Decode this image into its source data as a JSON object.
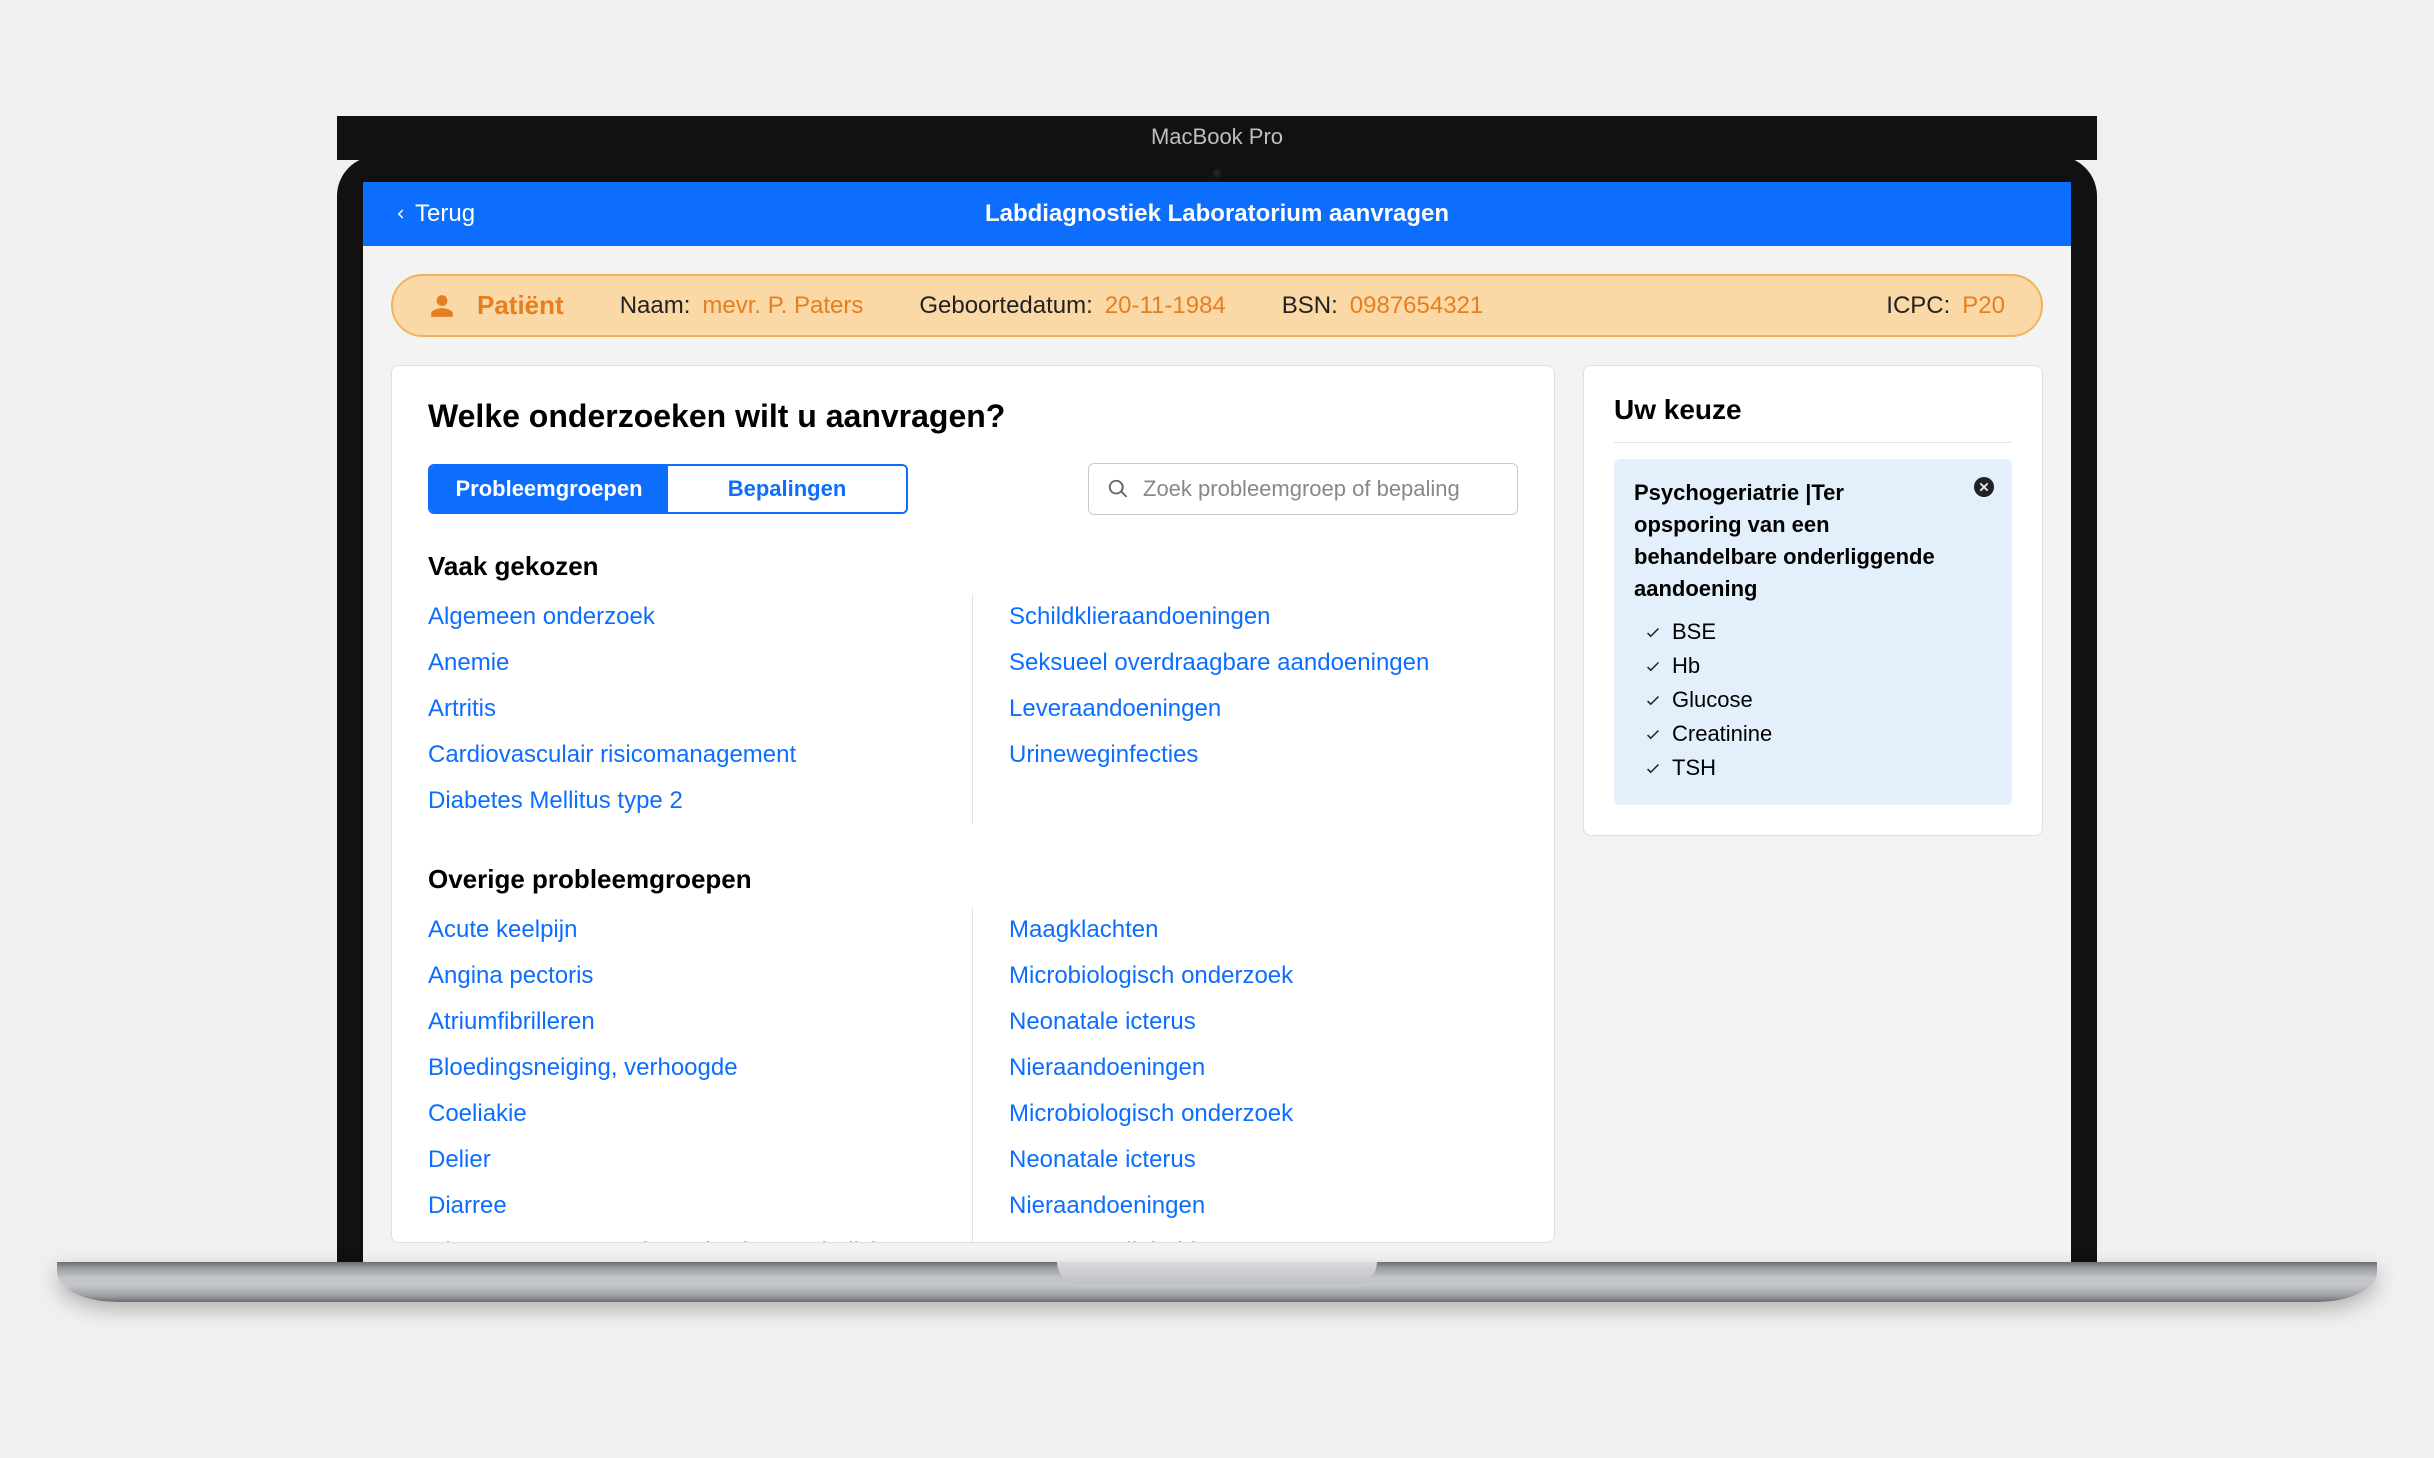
{
  "device_label": "MacBook Pro",
  "header": {
    "back_label": "Terug",
    "title": "Labdiagnostiek Laboratorium aanvragen"
  },
  "patient": {
    "badge_label": "Patiënt",
    "name_label": "Naam:",
    "name_value": "mevr. P. Paters",
    "dob_label": "Geboortedatum:",
    "dob_value": "20-11-1984",
    "bsn_label": "BSN:",
    "bsn_value": "0987654321",
    "icpc_label": "ICPC:",
    "icpc_value": "P20"
  },
  "main": {
    "heading": "Welke onderzoeken wilt u aanvragen?",
    "tab_groups": "Probleemgroepen",
    "tab_determinations": "Bepalingen",
    "search_placeholder": "Zoek probleemgroep of bepaling",
    "section_frequent": "Vaak gekozen",
    "frequent_col1": [
      "Algemeen onderzoek",
      "Anemie",
      "Artritis",
      "Cardiovasculair risicomanagement",
      "Diabetes Mellitus type 2"
    ],
    "frequent_col2": [
      "Schildklieraandoeningen",
      "Seksueel overdraagbare aandoeningen",
      "Leveraandoeningen",
      "Urineweginfecties"
    ],
    "section_other": "Overige probleemgroepen",
    "other_col1": [
      "Acute keelpijn",
      "Angina pectoris",
      "Atriumfibrilleren",
      "Bloedingsneiging, verhoogde",
      "Coeliakie",
      "Delier",
      "Diarree",
      "Diepe veneuze trombose (en longembolie)"
    ],
    "other_col2": [
      "Maagklachten",
      "Microbiologisch onderzoek",
      "Neonatale icterus",
      "Nieraandoeningen",
      "Microbiologisch onderzoek",
      "Neonatale icterus",
      "Nieraandoeningen",
      "Overgevoeligheid"
    ]
  },
  "sidebar": {
    "heading": "Uw keuze",
    "choice": {
      "title": "Psychogeriatrie |Ter opsporing van een behandelbare onderliggende aandoening",
      "items": [
        "BSE",
        "Hb",
        "Glucose",
        "Creatinine",
        "TSH"
      ]
    }
  }
}
